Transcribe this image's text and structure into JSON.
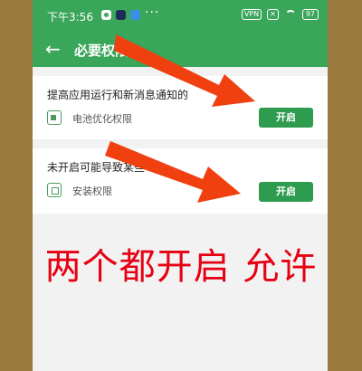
{
  "statusbar": {
    "time": "下午3:56",
    "dots": "···",
    "vpn": "VPN",
    "battery": "97"
  },
  "appbar": {
    "back_icon": "←",
    "title": "必要权限"
  },
  "permissions": [
    {
      "description": "提高应用运行和新消息通知的",
      "icon": "battery-icon",
      "label": "电池优化权限",
      "button": "开启"
    },
    {
      "description": "未开启可能导致某些",
      "icon": "install-icon",
      "label": "安装权限",
      "button": "开启"
    }
  ],
  "overlay": {
    "text": "两个都开启 允许",
    "color": "#e60012",
    "arrow_color": "#f04010"
  },
  "colors": {
    "green": "#3aa65a",
    "button_green": "#2e9c4f"
  }
}
